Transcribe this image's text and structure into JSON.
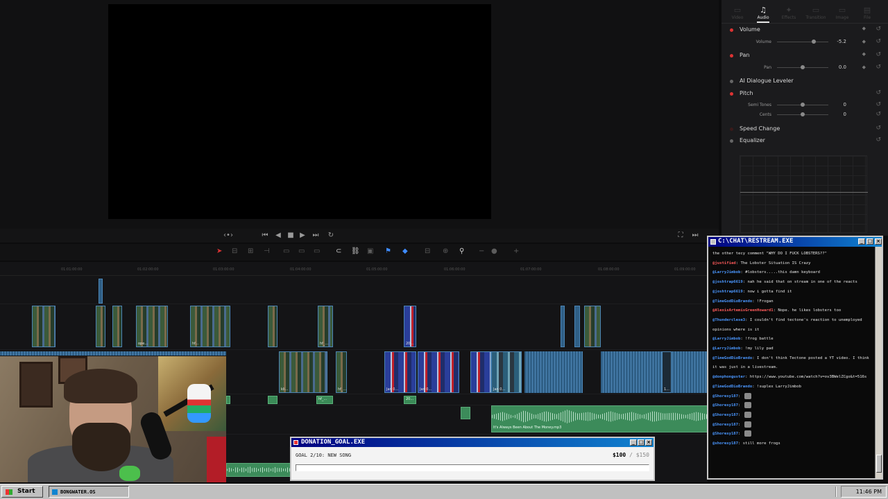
{
  "inspector": {
    "tabs": [
      {
        "label": "Video",
        "icon": "film-icon"
      },
      {
        "label": "Audio",
        "icon": "music-note-icon"
      },
      {
        "label": "Effects",
        "icon": "sparkle-icon"
      },
      {
        "label": "Transition",
        "icon": "transition-icon"
      },
      {
        "label": "Image",
        "icon": "image-icon"
      },
      {
        "label": "File",
        "icon": "file-icon"
      }
    ],
    "active_tab": "Audio",
    "volume": {
      "title": "Volume",
      "param": "Volume",
      "value": "-5.2"
    },
    "pan": {
      "title": "Pan",
      "param": "Pan",
      "value": "0.0"
    },
    "dialogue_leveler": "AI Dialogue Leveler",
    "pitch": {
      "title": "Pitch",
      "semi_label": "Semi Tones",
      "semi_value": "0",
      "cents_label": "Cents",
      "cents_value": "0"
    },
    "speed_change": "Speed Change",
    "equalizer": "Equalizer"
  },
  "timeline": {
    "ruler": [
      "01:01:00:00",
      "01:02:00:00",
      "01:03:00:00",
      "01:04:00:00",
      "01:05:00:00",
      "01:06:00:00",
      "01:07:00:00",
      "01:08:00:00",
      "01:09:00:00"
    ],
    "clip_labels": {
      "c1": "ope...",
      "c2": "hf...",
      "c3": "hf_...",
      "c4": "20...",
      "c5": "kli...",
      "c6": "hf_...",
      "c7": "Jan 0...",
      "c8": "Jan 0...",
      "c9": "Jan 0...",
      "c10": "1...",
      "g1": "hf_...",
      "g2": "20..."
    },
    "audio_clip_label": "It's Always Been About The Money.mp3"
  },
  "chat": {
    "title": "C:\\CHAT\\RESTREAM.EXE",
    "messages": [
      {
        "user": "",
        "text": "the other tecy comment \"WHY DO I FUCK LOBSTERS??\""
      },
      {
        "user": "@justified",
        "text": "The Lobster Situation IS Crazy",
        "red": true
      },
      {
        "user": "@LarryJimbob",
        "text": "#lobsters.....this damn keyboard"
      },
      {
        "user": "@joshtrap6619",
        "text": "nah he said that on stream in one of the reacts"
      },
      {
        "user": "@joshtrap6619",
        "text": "now i gotta find it"
      },
      {
        "user": "@TimeGodDioBrando",
        "text": "!Frogan"
      },
      {
        "user": "@AlexisArtemisGreenHoward1",
        "text": "Nope. he likes lobsters too",
        "red": true
      },
      {
        "user": "@Thunderclese3",
        "text": "I couldn't find tectone's reaction to unemployed opinions where is it"
      },
      {
        "user": "@LarryJimbob",
        "text": "!frog battle"
      },
      {
        "user": "@LarryJimbob",
        "text": "!my lily pad"
      },
      {
        "user": "@TimeGodDioBrando",
        "text": "I don't think Tectone posted a YT video. I think it was just in a livestream."
      },
      {
        "user": "@donphonguster",
        "text": "https://www.youtube.com/watch?v=ov3BWelZCgo&t=516s"
      },
      {
        "user": "@TimeGodDioBrando",
        "text": "!suplex LarryJimbob"
      },
      {
        "user": "@Shoresy187",
        "text": ""
      },
      {
        "user": "@Shoresy187",
        "text": ""
      },
      {
        "user": "@Shoresy187",
        "text": ""
      },
      {
        "user": "@Shoresy187",
        "text": ""
      },
      {
        "user": "@Shoresy187",
        "text": ""
      },
      {
        "user": "@shoresy187",
        "text": "still more frogs"
      }
    ]
  },
  "donation": {
    "title": "DONATION_GOAL.EXE",
    "goal_text": "GOAL 2/10: NEW SONG",
    "current": "$100",
    "separator": "/",
    "target": "$150",
    "progress": 0.0
  },
  "taskbar": {
    "start_label": "Start",
    "task_label": "BONGWATER.OS",
    "clock": "11:46 PM"
  },
  "colors": {
    "accent_red": "#dd3333",
    "clip_blue": "#2f5f86",
    "audio_green": "#3c8b5a",
    "win_title": "#000080"
  }
}
